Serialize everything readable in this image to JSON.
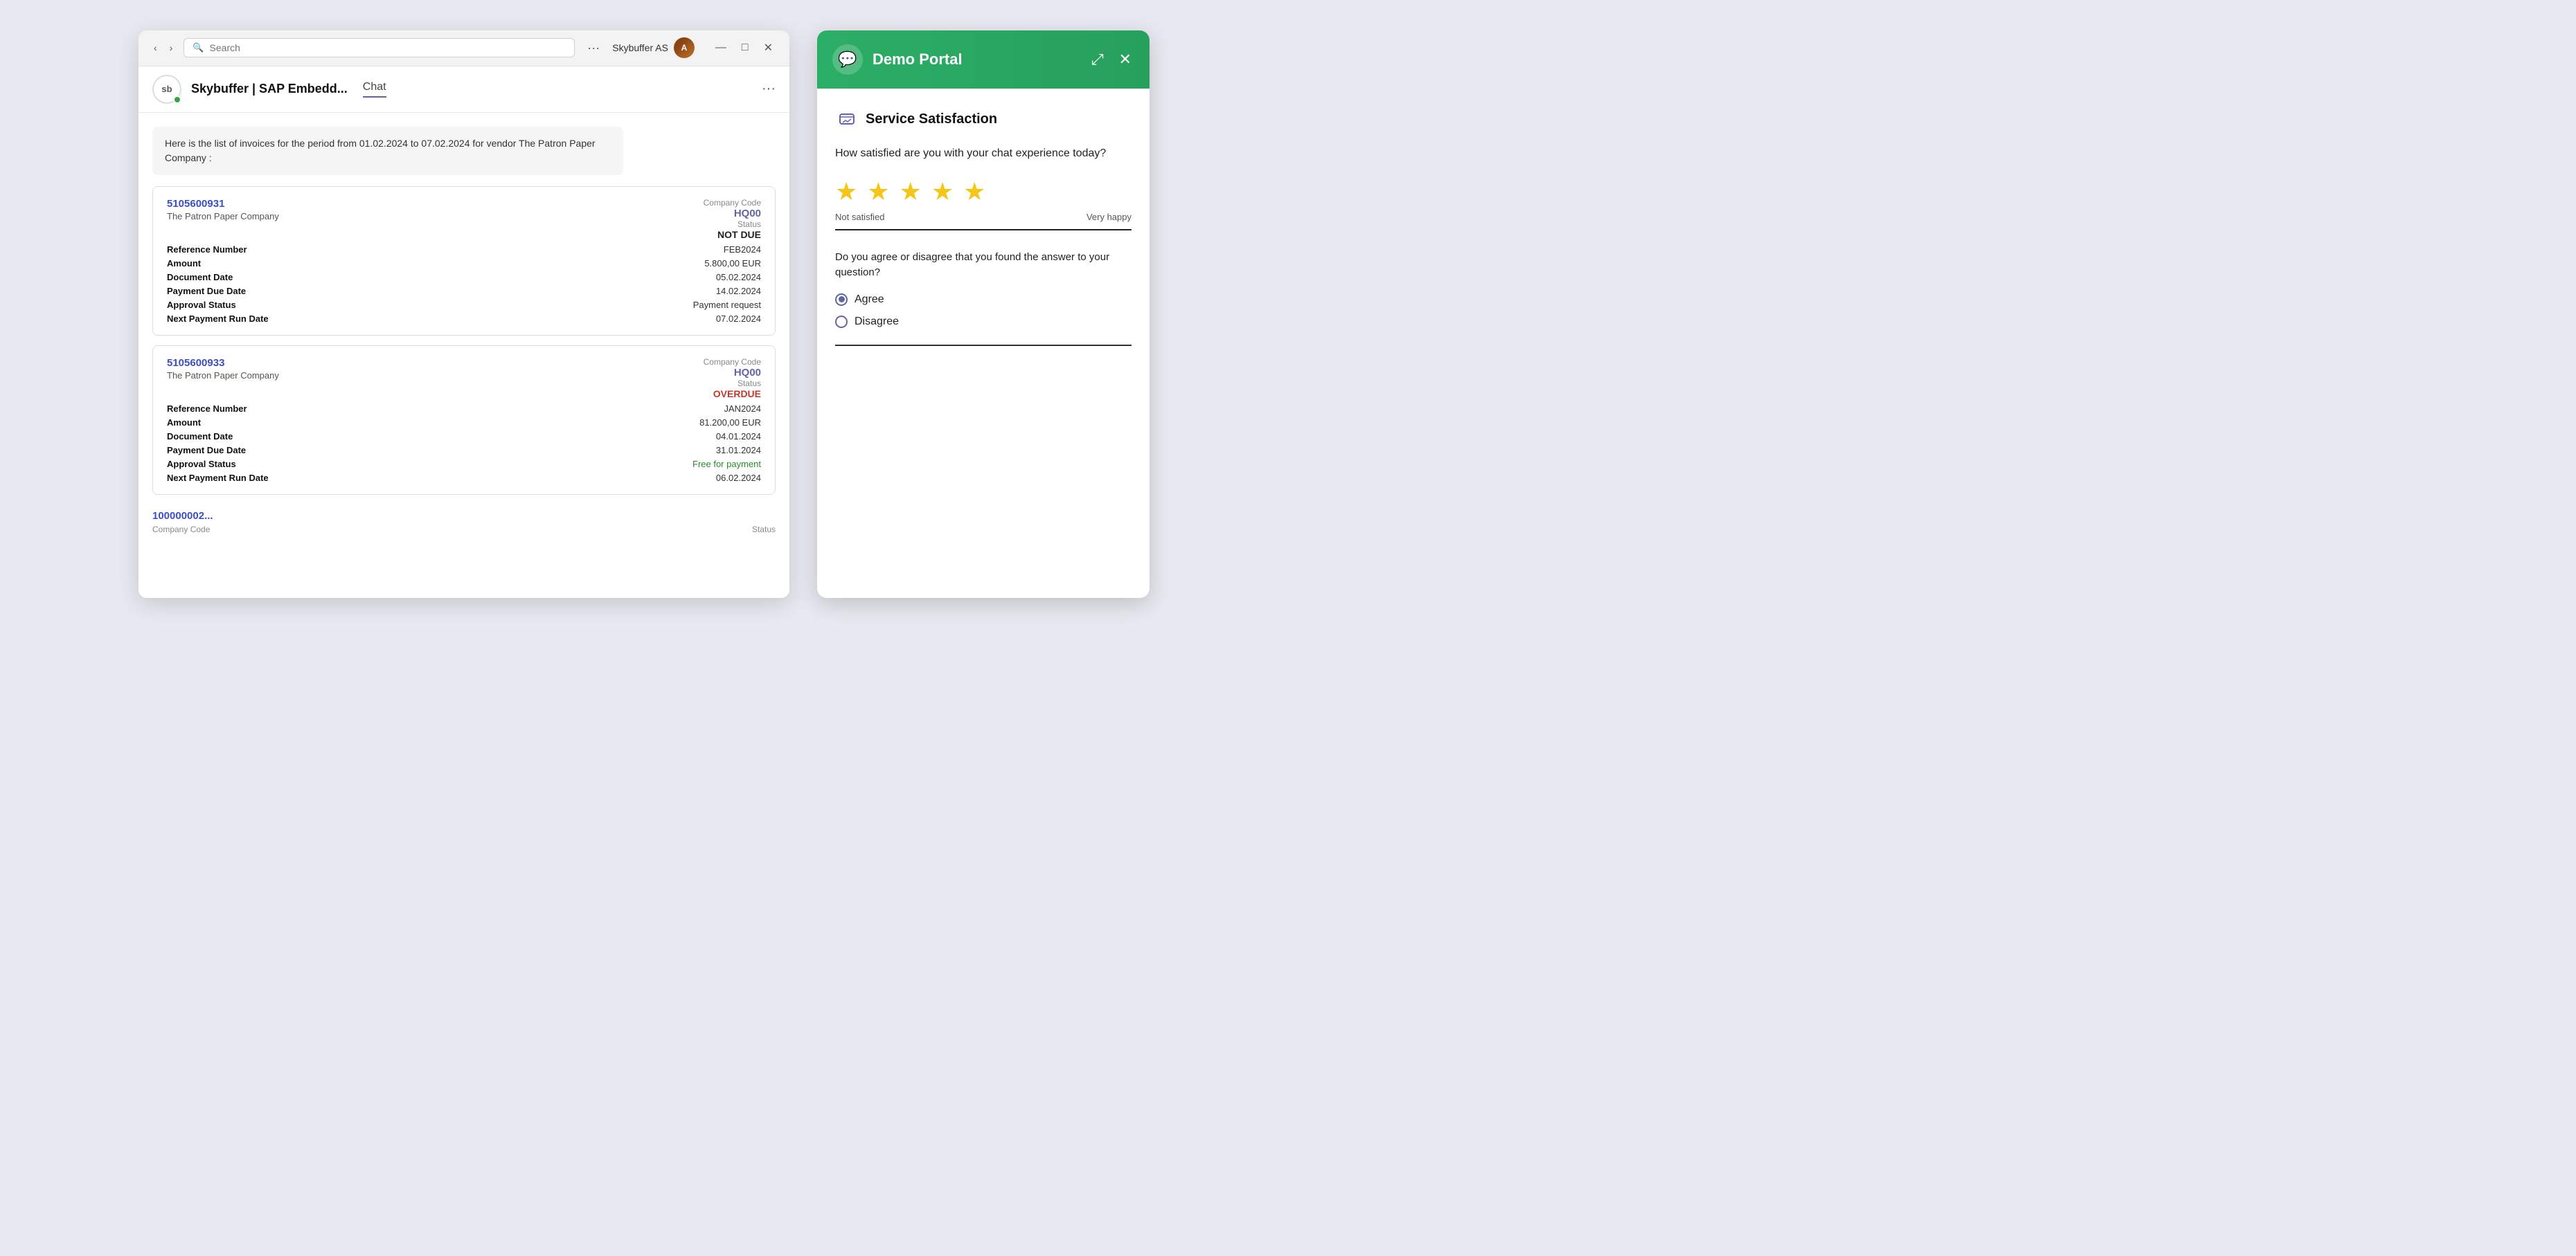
{
  "app": {
    "background_color": "#e8e9f0"
  },
  "teams": {
    "titlebar": {
      "search_placeholder": "Search",
      "more_label": "···",
      "user_name": "Skybuffer AS",
      "minimize": "—",
      "maximize": "□",
      "close": "✕"
    },
    "chat_header": {
      "logo_text": "sb",
      "title": "Skybuffer | SAP Embedd...",
      "tab": "Chat",
      "more": "···"
    },
    "message": {
      "text": "Here is the list of invoices for the period from 01.02.2024 to 07.02.2024 for vendor The Patron Paper Company :"
    },
    "invoices": [
      {
        "id": "inv1",
        "number": "5105600931",
        "company": "The Patron Paper Company",
        "company_code_label": "Company Code",
        "company_code": "HQ00",
        "status_label": "Status",
        "status": "NOT DUE",
        "status_type": "not-due",
        "ref_label": "Reference Number",
        "ref_val": "FEB2024",
        "amount_label": "Amount",
        "amount_val": "5.800,00 EUR",
        "doc_date_label": "Document Date",
        "doc_date_val": "05.02.2024",
        "pay_due_label": "Payment Due Date",
        "pay_due_val": "14.02.2024",
        "approval_label": "Approval Status",
        "approval_val": "Payment request",
        "next_pay_label": "Next Payment Run Date",
        "next_pay_val": "07.02.2024"
      },
      {
        "id": "inv2",
        "number": "5105600933",
        "company": "The Patron Paper Company",
        "company_code_label": "Company Code",
        "company_code": "HQ00",
        "status_label": "Status",
        "status": "OVERDUE",
        "status_type": "overdue",
        "ref_label": "Reference Number",
        "ref_val": "JAN2024",
        "amount_label": "Amount",
        "amount_val": "81.200,00 EUR",
        "doc_date_label": "Document Date",
        "doc_date_val": "04.01.2024",
        "pay_due_label": "Payment Due Date",
        "pay_due_val": "31.01.2024",
        "approval_label": "Approval Status",
        "approval_val": "Free for payment",
        "approval_green": true,
        "next_pay_label": "Next Payment Run Date",
        "next_pay_val": "06.02.2024"
      }
    ]
  },
  "widget": {
    "header": {
      "icon": "💬",
      "title": "Demo Portal",
      "expand_icon": "⤢",
      "close_icon": "✕"
    },
    "satisfaction": {
      "icon": "💬",
      "title": "Service Satisfaction",
      "question1": "How satisfied are you with your chat experience today?",
      "star_count": 5,
      "star_label_left": "Not satisfied",
      "star_label_right": "Very happy",
      "question2": "Do you agree or disagree that you found the answer to your question?",
      "options": [
        {
          "id": "agree",
          "label": "Agree",
          "selected": true
        },
        {
          "id": "disagree",
          "label": "Disagree",
          "selected": false
        }
      ]
    }
  }
}
